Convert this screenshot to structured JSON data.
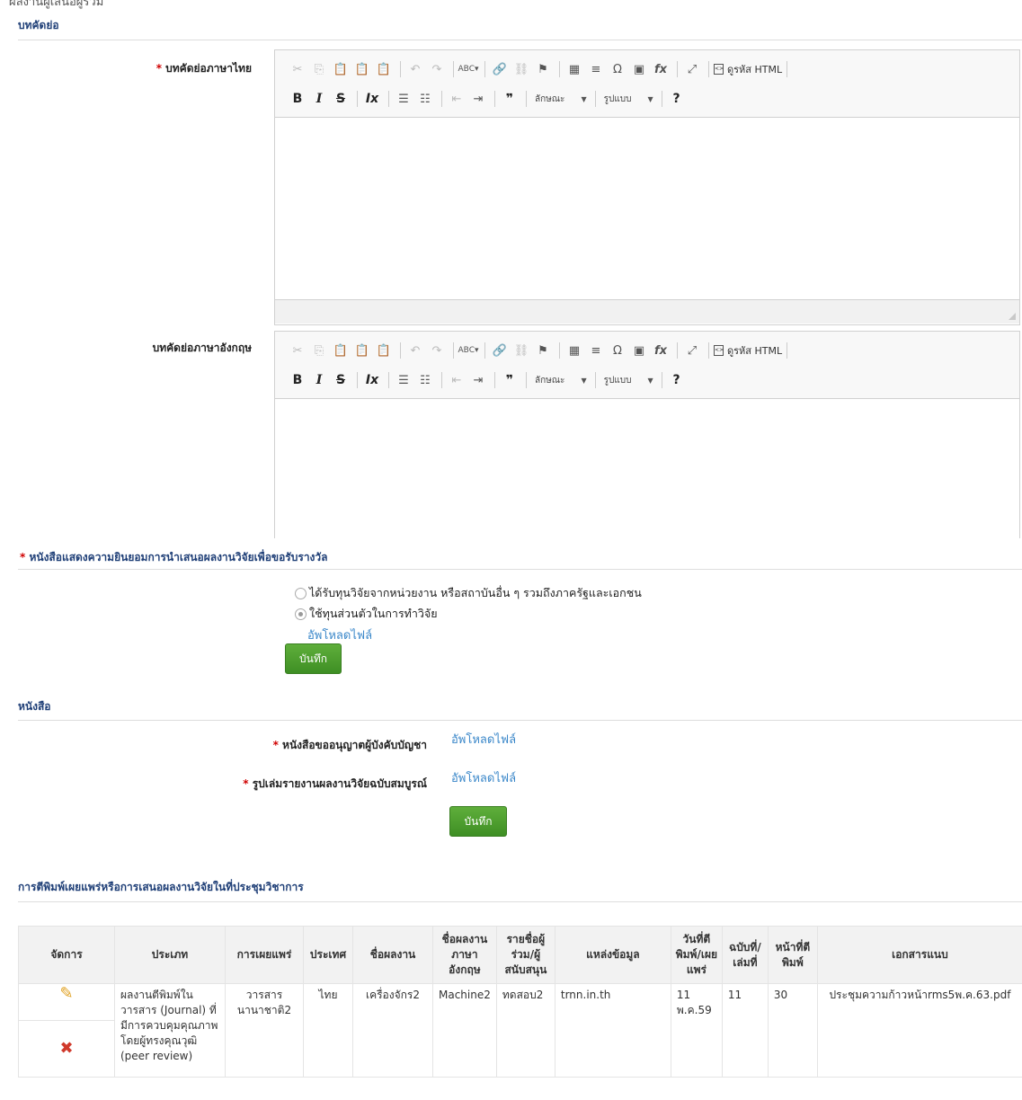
{
  "cut_header": "ผลงานผู้เสนอผู้ร่วม",
  "abstract": {
    "section_title": "บทคัดย่อ",
    "thai_label": "บทคัดย่อภาษาไทย",
    "english_label": "บทคัดย่อภาษาอังกฤษ",
    "thai_value": "",
    "english_value": "",
    "toolbar": {
      "source_label": "ดูรหัส HTML",
      "style_select": "ลักษณะ",
      "format_select": "รูปแบบ",
      "help": "?"
    }
  },
  "consent": {
    "section_title": "หนังสือแสดงความยินยอมการนำเสนอผลงานวิจัยเพื่อขอรับรางวัล",
    "option_1": "ได้รับทุนวิจัยจากหน่วยงาน หรือสถาบันอื่น ๆ รวมถึงภาครัฐและเอกชน",
    "option_2": "ใช้ทุนส่วนตัวในการทำวิจัย",
    "selected": 2,
    "upload_link": "อัพโหลดไฟล์",
    "save_button": "บันทึก"
  },
  "letters": {
    "section_title": "หนังสือ",
    "permission_label": "หนังสือขออนุญาตผู้บังคับบัญชา",
    "permission_upload": "อัพโหลดไฟล์",
    "report_label": "รูปเล่มรายงานผลงานวิจัยฉบับสมบูรณ์",
    "report_upload": "อัพโหลดไฟล์",
    "save_button": "บันทึก"
  },
  "publication": {
    "section_title": "การตีพิมพ์เผยแพร่หรือการเสนอผลงานวิจัยในที่ประชุมวิชาการ",
    "headers": {
      "manage": "จัดการ",
      "type": "ประเภท",
      "dissemination": "การเผยแพร่",
      "country": "ประเทศ",
      "title": "ชื่อผลงาน",
      "title_en": "ชื่อผลงานภาษาอังกฤษ",
      "coauthors": "รายชื่อผู้ร่วม/ผู้สนับสนุน",
      "source": "แหล่งข้อมูล",
      "date": "วันที่ตีพิมพ์/เผยแพร่",
      "issue": "ฉบับที่/เล่มที่",
      "pages": "หน้าที่ตีพิมพ์",
      "attachment": "เอกสารแนบ"
    },
    "rows": [
      {
        "type": "ผลงานตีพิมพ์ในวารสาร (Journal) ที่มีการควบคุมคุณภาพโดยผู้ทรงคุณวุฒิ (peer review)",
        "dissemination": "วารสารนานาชาติ2",
        "country": "ไทย",
        "title": "เครื่องจักร2",
        "title_en": "Machine2",
        "coauthors": "ทดสอบ2",
        "source": "trnn.in.th",
        "date": "11 พ.ค.59",
        "issue": "11",
        "pages": "30",
        "attachment": "ประชุมความก้าวหน้าrms5พ.ค.63.pdf"
      }
    ]
  }
}
